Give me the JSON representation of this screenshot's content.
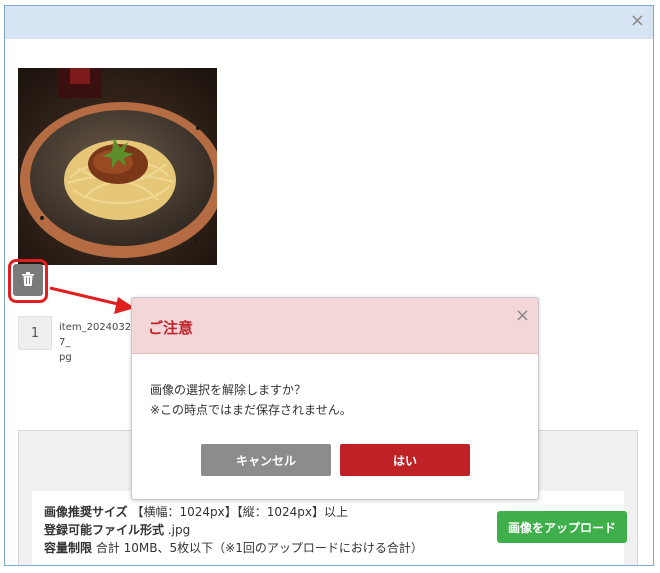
{
  "window": {
    "close_icon": "×"
  },
  "image_item": {
    "photo_icon": "spaghetti-photo",
    "delete_icon": "trash-icon",
    "index": "1",
    "filename": "item_20240327_\npg"
  },
  "upload": {
    "size_label": "画像推奨サイズ",
    "size_value": "【横幅：1024px】【縦：1024px】以上",
    "format_label": "登録可能ファイル形式",
    "format_value": ".jpg",
    "limit_label": "容量制限",
    "limit_value": "合計 10MB、5枚以下（※1回のアップロードにおける合計）",
    "button_label": "画像をアップロード"
  },
  "dialog": {
    "title": "ご注意",
    "close_icon": "×",
    "message_line1": "画像の選択を解除しますか？",
    "message_line2": "※この時点ではまだ保存されません。",
    "cancel_label": "キャンセル",
    "confirm_label": "はい"
  },
  "colors": {
    "header_bg": "#d6e4f4",
    "dialog_header_bg": "#f2d6d8",
    "dialog_title": "#c0262c",
    "confirm_button": "#be2227",
    "cancel_button": "#8c8c8c",
    "upload_button": "#3eaf4a",
    "highlight": "#e02020"
  }
}
